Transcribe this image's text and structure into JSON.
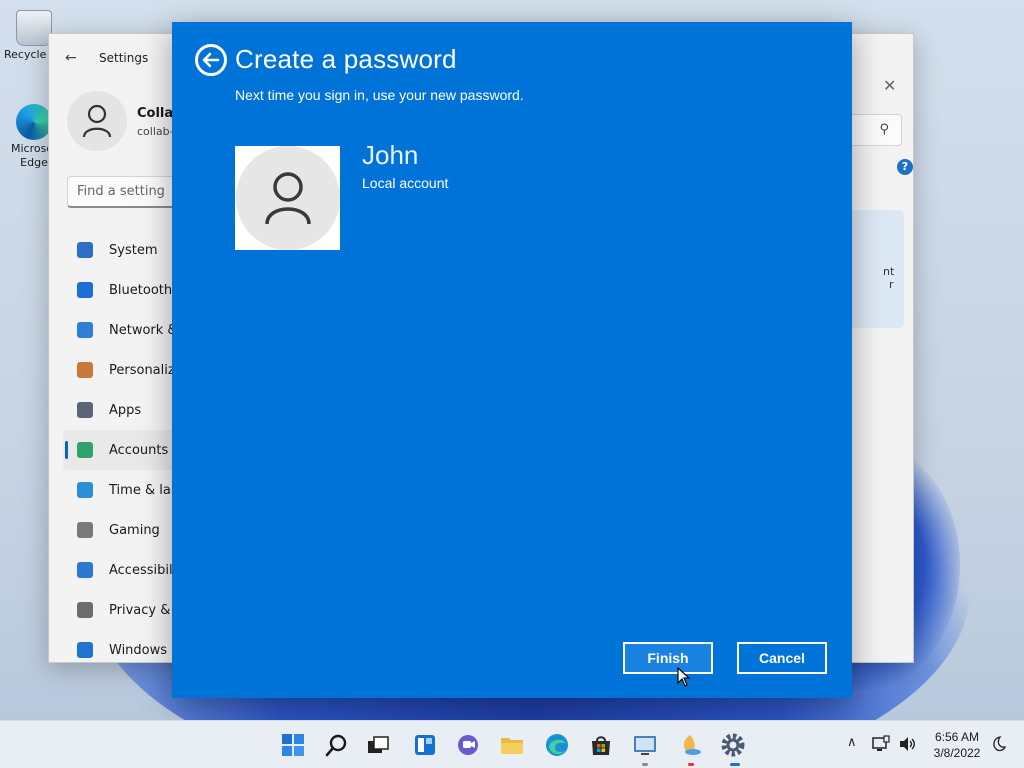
{
  "desktop": {
    "icons": [
      {
        "label": "Recycle Bin"
      },
      {
        "label": "Microsoft Edge"
      }
    ]
  },
  "settings": {
    "title": "Settings",
    "profile": {
      "name": "Collab",
      "email": "collab-"
    },
    "search_placeholder": "Find a setting",
    "nav": [
      {
        "label": "System",
        "color": "#2b6fc9"
      },
      {
        "label": "Bluetooth",
        "color": "#1d6fd6"
      },
      {
        "label": "Network &",
        "color": "#2f7fd8"
      },
      {
        "label": "Personaliza",
        "color": "#c9793a"
      },
      {
        "label": "Apps",
        "color": "#5a6578"
      },
      {
        "label": "Accounts",
        "color": "#2ea36b"
      },
      {
        "label": "Time & lan",
        "color": "#2b8fd8"
      },
      {
        "label": "Gaming",
        "color": "#7a7a7a"
      },
      {
        "label": "Accessibili",
        "color": "#2a78d2"
      },
      {
        "label": "Privacy & s",
        "color": "#6d6d6d"
      },
      {
        "label": "Windows U",
        "color": "#1f74d0"
      }
    ],
    "active_item": "Accounts",
    "right_card": [
      "nt",
      "r"
    ]
  },
  "dialog": {
    "title": "Create a password",
    "subtitle": "Next time you sign in, use your new password.",
    "user_name": "John",
    "account_type": "Local account",
    "finish_label": "Finish",
    "cancel_label": "Cancel",
    "accent": "#0073d8"
  },
  "taskbar": {
    "time": "6:56 AM",
    "date": "3/8/2022",
    "icons": [
      "start-icon",
      "search-icon",
      "task-view-icon",
      "widgets-icon",
      "chat-icon",
      "file-explorer-icon",
      "edge-icon",
      "store-icon",
      "control-panel-icon",
      "paint-icon",
      "settings-icon"
    ]
  }
}
